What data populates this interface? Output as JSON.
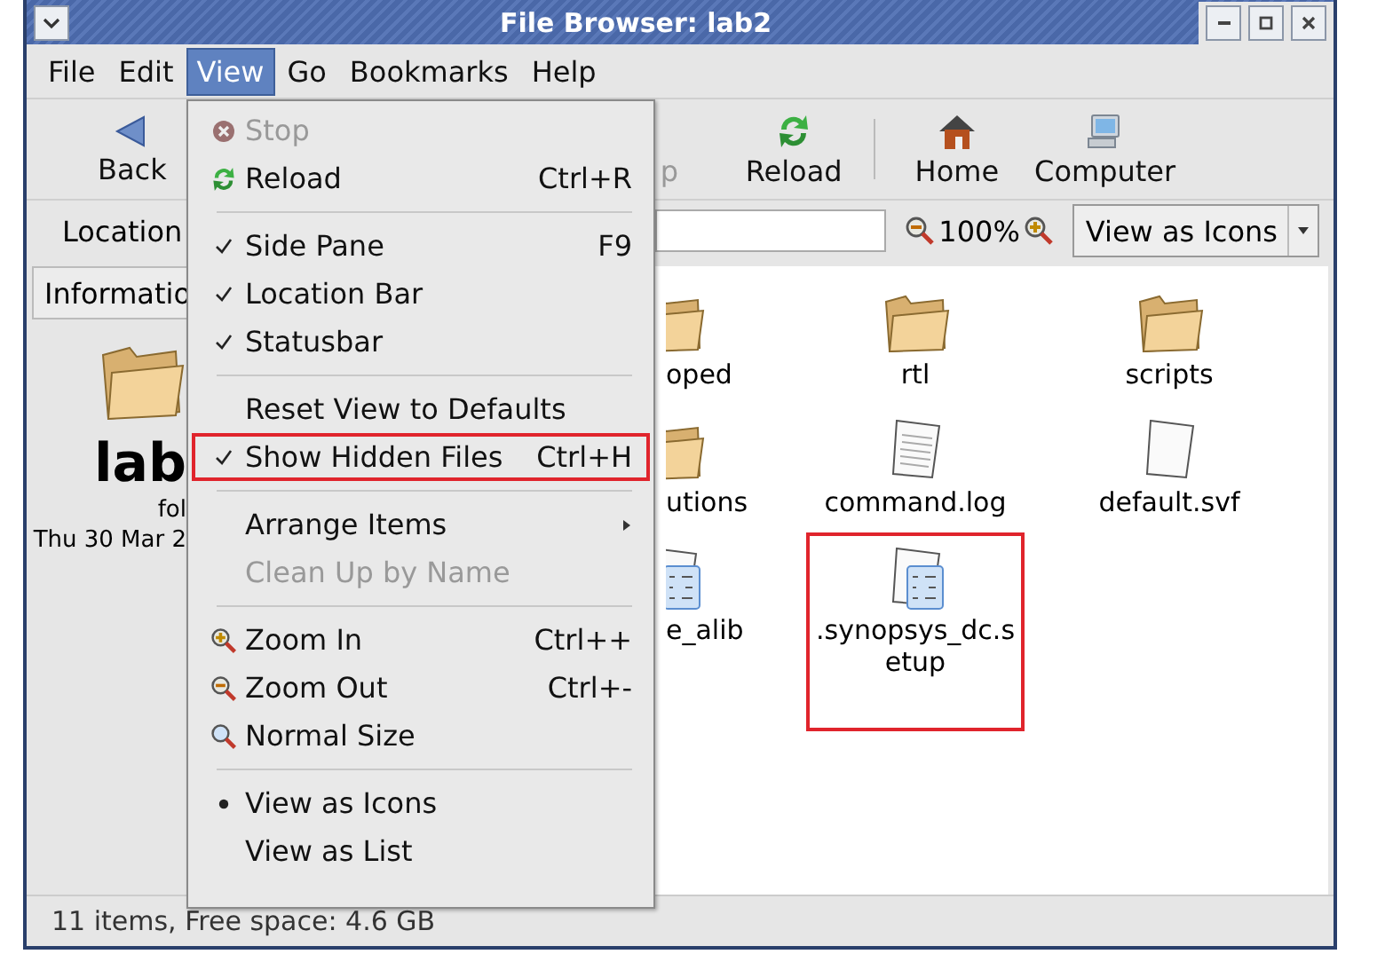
{
  "window": {
    "title": "File Browser: lab2"
  },
  "menu_bar": [
    {
      "label": "File",
      "selected": false
    },
    {
      "label": "Edit",
      "selected": false
    },
    {
      "label": "View",
      "selected": true
    },
    {
      "label": "Go",
      "selected": false
    },
    {
      "label": "Bookmarks",
      "selected": false
    },
    {
      "label": "Help",
      "selected": false
    }
  ],
  "toolbar": [
    {
      "kind": "back",
      "label": "Back",
      "disabled": false
    },
    {
      "kind": "stop",
      "label": "p",
      "disabled": true
    },
    {
      "kind": "reload",
      "label": "Reload",
      "disabled": false
    },
    {
      "kind": "separator"
    },
    {
      "kind": "home",
      "label": "Home",
      "disabled": false
    },
    {
      "kind": "computer",
      "label": "Computer",
      "disabled": false
    }
  ],
  "location_bar": {
    "label": "Location",
    "zoom": "100%",
    "view_select": "View as Icons"
  },
  "side_pane": {
    "selector": "Informatio",
    "name": "lab",
    "type": "fol",
    "date": "Thu 30 Mar 2"
  },
  "files": [
    {
      "name": "oped",
      "kind": "folder",
      "partial": true,
      "highlighted": false
    },
    {
      "name": "rtl",
      "kind": "folder",
      "partial": false,
      "highlighted": false
    },
    {
      "name": "scripts",
      "kind": "folder",
      "partial": false,
      "highlighted": false
    },
    {
      "name": "utions",
      "kind": "folder",
      "partial": true,
      "highlighted": false
    },
    {
      "name": "command.log",
      "kind": "text",
      "partial": false,
      "highlighted": false
    },
    {
      "name": "default.svf",
      "kind": "blank",
      "partial": false,
      "highlighted": false
    },
    {
      "name": "e_alib",
      "kind": "script",
      "partial": true,
      "highlighted": false
    },
    {
      "name": ".synopsys_dc.setup",
      "kind": "script",
      "partial": false,
      "highlighted": true
    }
  ],
  "status_bar": "11 items, Free space: 4.6 GB",
  "view_menu": [
    {
      "kind": "stop",
      "label": "Stop",
      "disabled": true,
      "highlighted": false
    },
    {
      "kind": "reload",
      "label": "Reload",
      "shortcut": "Ctrl+R",
      "disabled": false,
      "highlighted": false
    },
    {
      "kind": "separator"
    },
    {
      "kind": "check",
      "label": "Side Pane",
      "shortcut": "F9",
      "checked": true,
      "disabled": false,
      "highlighted": false
    },
    {
      "kind": "check",
      "label": "Location Bar",
      "checked": true,
      "disabled": false,
      "highlighted": false
    },
    {
      "kind": "check",
      "label": "Statusbar",
      "checked": true,
      "disabled": false,
      "highlighted": false
    },
    {
      "kind": "separator"
    },
    {
      "kind": "plain",
      "label": "Reset View to Defaults",
      "disabled": false,
      "highlighted": false
    },
    {
      "kind": "check",
      "label": "Show Hidden Files",
      "shortcut": "Ctrl+H",
      "checked": true,
      "disabled": false,
      "highlighted": true
    },
    {
      "kind": "separator"
    },
    {
      "kind": "submenu",
      "label": "Arrange Items",
      "disabled": false,
      "highlighted": false
    },
    {
      "kind": "plain",
      "label": "Clean Up by Name",
      "disabled": true,
      "highlighted": false
    },
    {
      "kind": "separator"
    },
    {
      "kind": "zoomin",
      "label": "Zoom In",
      "shortcut": "Ctrl++",
      "disabled": false,
      "highlighted": false
    },
    {
      "kind": "zoomout",
      "label": "Zoom Out",
      "shortcut": "Ctrl+-",
      "disabled": false,
      "highlighted": false
    },
    {
      "kind": "zoomnormal",
      "label": "Normal Size",
      "disabled": false,
      "highlighted": false
    },
    {
      "kind": "separator"
    },
    {
      "kind": "radio",
      "label": "View as Icons",
      "checked": true,
      "disabled": false,
      "highlighted": false
    },
    {
      "kind": "radio",
      "label": "View as List",
      "checked": false,
      "disabled": false,
      "highlighted": false
    }
  ]
}
